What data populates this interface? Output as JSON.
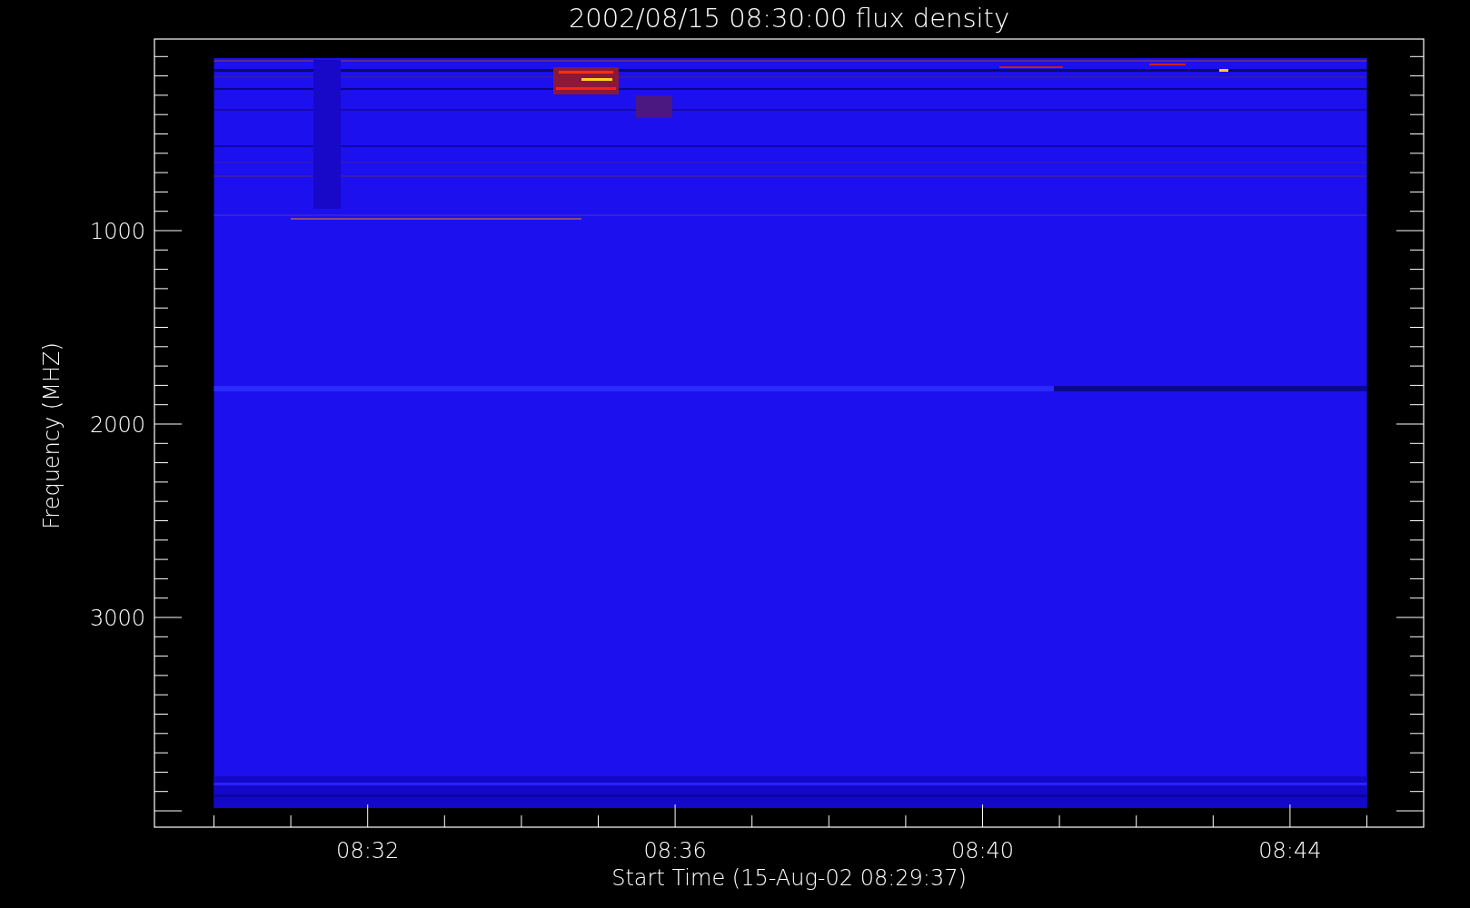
{
  "plot": {
    "title": "2002/08/15 08:30:00 flux density",
    "xlabel": "Start Time (15-Aug-02 08:29:37)",
    "ylabel": "Frequency (MHZ)",
    "xtick_labels": [
      "08:32",
      "08:36",
      "08:40",
      "08:44"
    ],
    "ytick_labels": [
      "1000",
      "2000",
      "3000"
    ]
  }
}
